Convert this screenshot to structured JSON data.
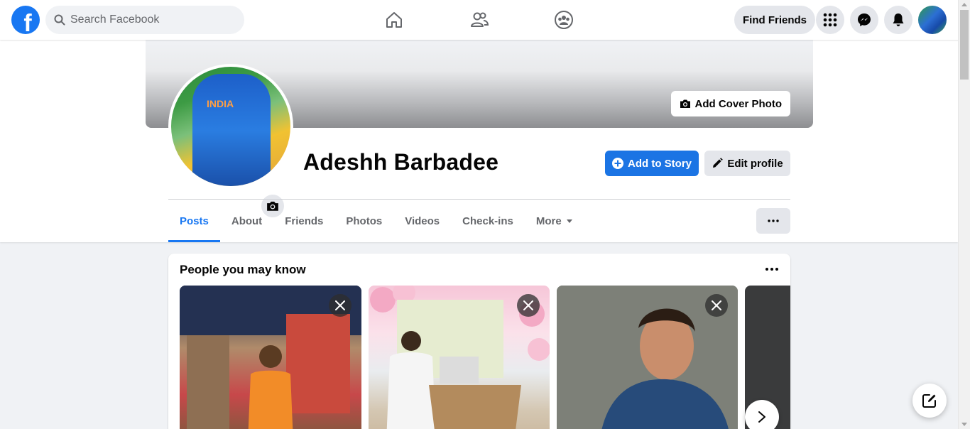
{
  "app": {
    "logo_letter": "f",
    "brand_color": "#1877f2"
  },
  "search": {
    "placeholder": "Search Facebook",
    "value": ""
  },
  "top_nav": {
    "icons": [
      "home-icon",
      "friends-icon",
      "groups-icon"
    ],
    "find_friends_label": "Find Friends",
    "right_icons": [
      "menu-grid-icon",
      "messenger-icon",
      "notifications-bell-icon",
      "account-avatar"
    ]
  },
  "profile": {
    "name": "Adeshh Barbadee",
    "photo_jersey_text": "INDIA",
    "add_cover_label": "Add Cover Photo",
    "add_to_story_label": "Add to Story",
    "edit_profile_label": "Edit profile"
  },
  "tabs": [
    {
      "label": "Posts",
      "active": true
    },
    {
      "label": "About",
      "active": false
    },
    {
      "label": "Friends",
      "active": false
    },
    {
      "label": "Photos",
      "active": false
    },
    {
      "label": "Videos",
      "active": false
    },
    {
      "label": "Check-ins",
      "active": false
    },
    {
      "label": "More",
      "active": false
    }
  ],
  "people_you_may_know": {
    "title": "People you may know",
    "cards": [
      {
        "description": "person-in-orange-shirt"
      },
      {
        "description": "person-at-podium"
      },
      {
        "description": "person-in-blue-tshirt"
      },
      {
        "description": "partial-card"
      }
    ]
  }
}
